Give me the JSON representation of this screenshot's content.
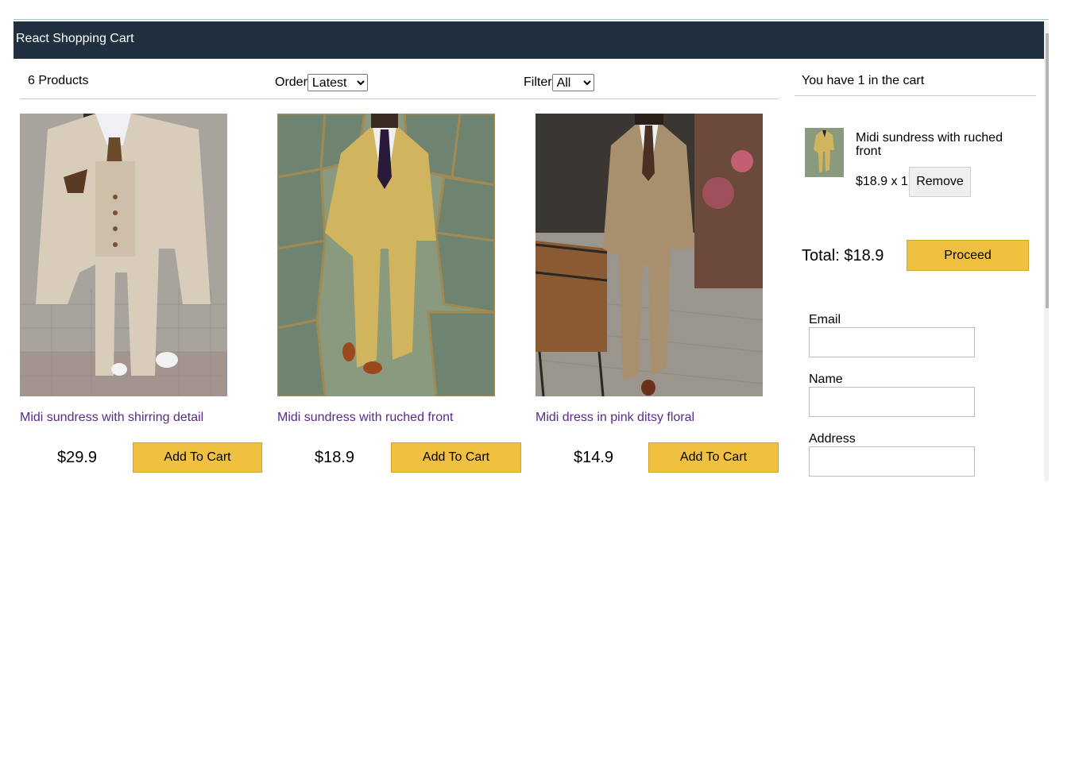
{
  "header": {
    "brand": "React Shopping Cart",
    "bg_color": "#203040"
  },
  "filter_bar": {
    "count_text": "6 Products",
    "order_label": "Order",
    "order_selected": "Latest",
    "filter_label": "Filter",
    "filter_selected": "All"
  },
  "products": [
    {
      "title": "Midi sundress with shirring detail",
      "price": "$29.9",
      "button": "Add To Cart",
      "image": "beige-three-piece-suit"
    },
    {
      "title": "Midi sundress with ruched front",
      "price": "$18.9",
      "button": "Add To Cart",
      "image": "mustard-suit-stone-wall"
    },
    {
      "title": "Midi dress in pink ditsy floral",
      "price": "$14.9",
      "button": "Add To Cart",
      "image": "brown-suit-bench"
    }
  ],
  "cart": {
    "header_text": "You have 1 in the cart",
    "items": [
      {
        "name": "Midi sundress with ruched front",
        "qty_text": "$18.9 x 1",
        "remove_label": "Remove"
      }
    ],
    "total_text": "Total: $18.9",
    "proceed_label": "Proceed"
  },
  "checkout_form": {
    "email_label": "Email",
    "name_label": "Name",
    "address_label": "Address"
  },
  "colors": {
    "accent": "#f0c040",
    "title_link": "#5a2a8a"
  }
}
